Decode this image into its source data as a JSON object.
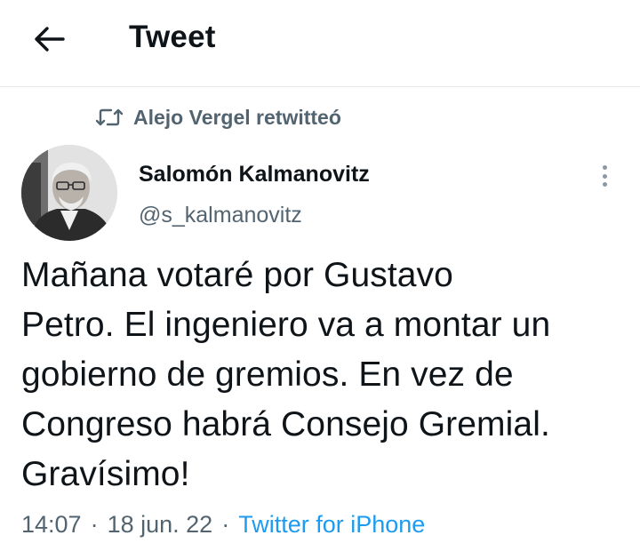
{
  "header": {
    "back_icon": "arrow-left-icon",
    "title": "Tweet"
  },
  "retweet": {
    "icon": "retweet-icon",
    "text": "Alejo Vergel retwitteó"
  },
  "tweet": {
    "author_name": "Salomón Kalmanovitz",
    "author_handle": "@s_kalmanovitz",
    "text": "Mañana votaré por Gustavo\nPetro. El ingeniero va a montar un\ngobierno de gremios. En vez de\nCongreso habrá Consejo Gremial.\nGravísimo!",
    "time": "14:07",
    "date": "18 jun. 22",
    "separator": "·",
    "source": "Twitter for iPhone"
  },
  "colors": {
    "text_primary": "#0f1419",
    "text_secondary": "#536471",
    "link": "#1d9bf0",
    "divider": "#e6e9eb"
  }
}
